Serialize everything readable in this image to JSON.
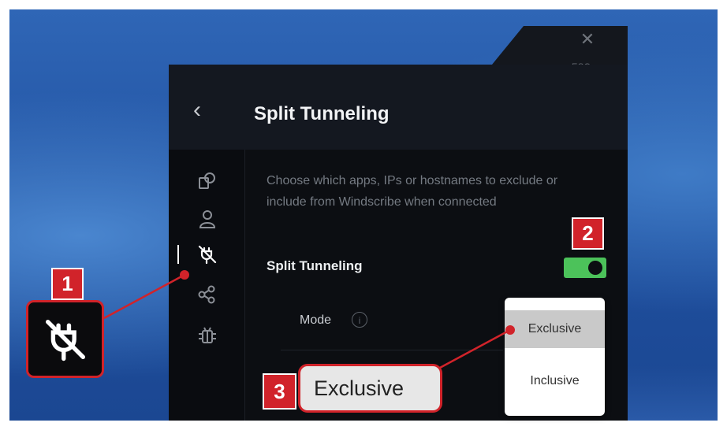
{
  "header": {
    "title": "Split Tunneling",
    "esc_label": "ESC"
  },
  "sidebar": {
    "items": [
      {
        "icon": "general-settings-icon"
      },
      {
        "icon": "account-icon"
      },
      {
        "icon": "split-tunneling-plug-icon",
        "active": true
      },
      {
        "icon": "share-icon"
      },
      {
        "icon": "debug-bug-icon"
      }
    ]
  },
  "content": {
    "description": "Choose which apps, IPs or hostnames to exclude or include from Windscribe when connected",
    "split_tunneling_label": "Split Tunneling",
    "split_tunneling_enabled": true,
    "mode_label": "Mode",
    "mode_value": "Exclusive"
  },
  "dropdown": {
    "options": [
      "Exclusive",
      "Inclusive"
    ],
    "selected": "Exclusive"
  },
  "callouts": [
    {
      "number": "1"
    },
    {
      "number": "2"
    },
    {
      "number": "3"
    }
  ],
  "colors": {
    "callout_red": "#d1232a",
    "toggle_green": "#4cc25a",
    "panel_bg": "#0c0e12"
  }
}
